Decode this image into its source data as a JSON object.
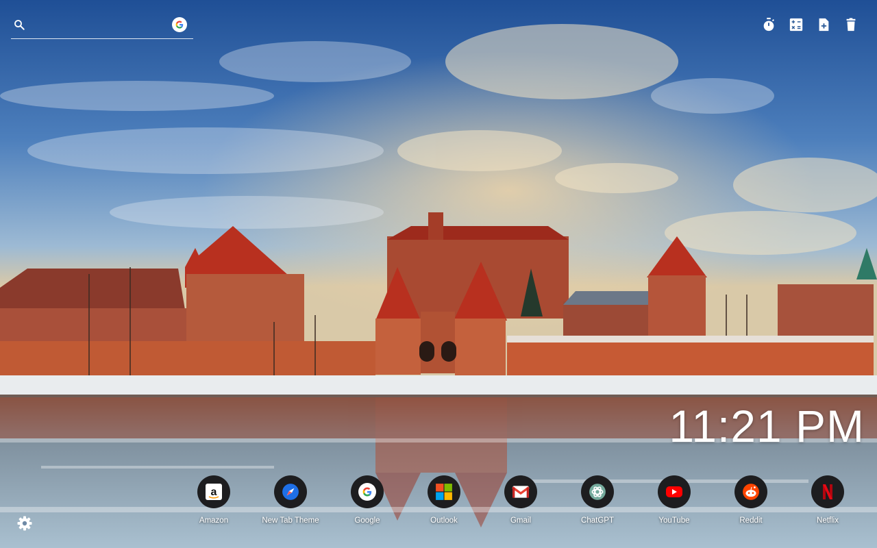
{
  "search": {
    "placeholder": "",
    "value": ""
  },
  "toolbar": {
    "icons": [
      "timer-icon",
      "calculator-icon",
      "new-note-icon",
      "trash-icon"
    ]
  },
  "clock": {
    "time": "11:21 PM"
  },
  "shortcuts": [
    {
      "label": "Amazon",
      "icon": "amazon-icon"
    },
    {
      "label": "New Tab Theme",
      "icon": "new-tab-theme-icon"
    },
    {
      "label": "Google",
      "icon": "google-icon"
    },
    {
      "label": "Outlook",
      "icon": "microsoft-icon"
    },
    {
      "label": "Gmail",
      "icon": "gmail-icon"
    },
    {
      "label": "ChatGPT",
      "icon": "chatgpt-icon"
    },
    {
      "label": "YouTube",
      "icon": "youtube-icon"
    },
    {
      "label": "Reddit",
      "icon": "reddit-icon"
    },
    {
      "label": "Netflix",
      "icon": "netflix-icon"
    }
  ],
  "settings": {
    "icon": "gear-icon"
  },
  "colors": {
    "sky_top": "#1f4f96",
    "brick": "#b5482a",
    "roof": "#a7281a",
    "ice": "#8fa7b8",
    "shortcut_bg": "#1d1d1f"
  }
}
